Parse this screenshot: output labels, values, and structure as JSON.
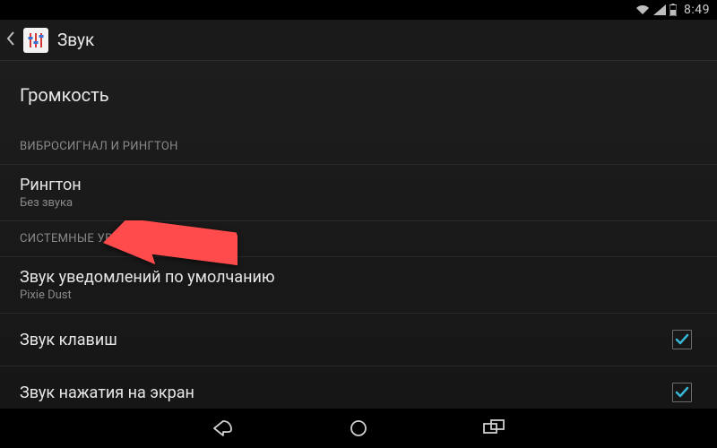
{
  "status": {
    "time": "8:49"
  },
  "header": {
    "title": "Звук"
  },
  "rows": {
    "volume": {
      "title": "Громкость"
    },
    "section_vibro": {
      "title": "ВИБРОСИГНАЛ И РИНГТОН"
    },
    "ringtone": {
      "title": "Рингтон",
      "sub": "Без звука"
    },
    "section_system": {
      "title": "СИСТЕМНЫЕ УВЕДОМЛЕНИЯ"
    },
    "default_notif": {
      "title": "Звук уведомлений по умолчанию",
      "sub": "Pixie Dust"
    },
    "dial_pad": {
      "title": "Звук клавиш"
    },
    "touch_sounds": {
      "title": "Звук нажатия на экран"
    }
  },
  "colors": {
    "accent": "#36b7d7",
    "annotation": "#ff4b4b"
  }
}
